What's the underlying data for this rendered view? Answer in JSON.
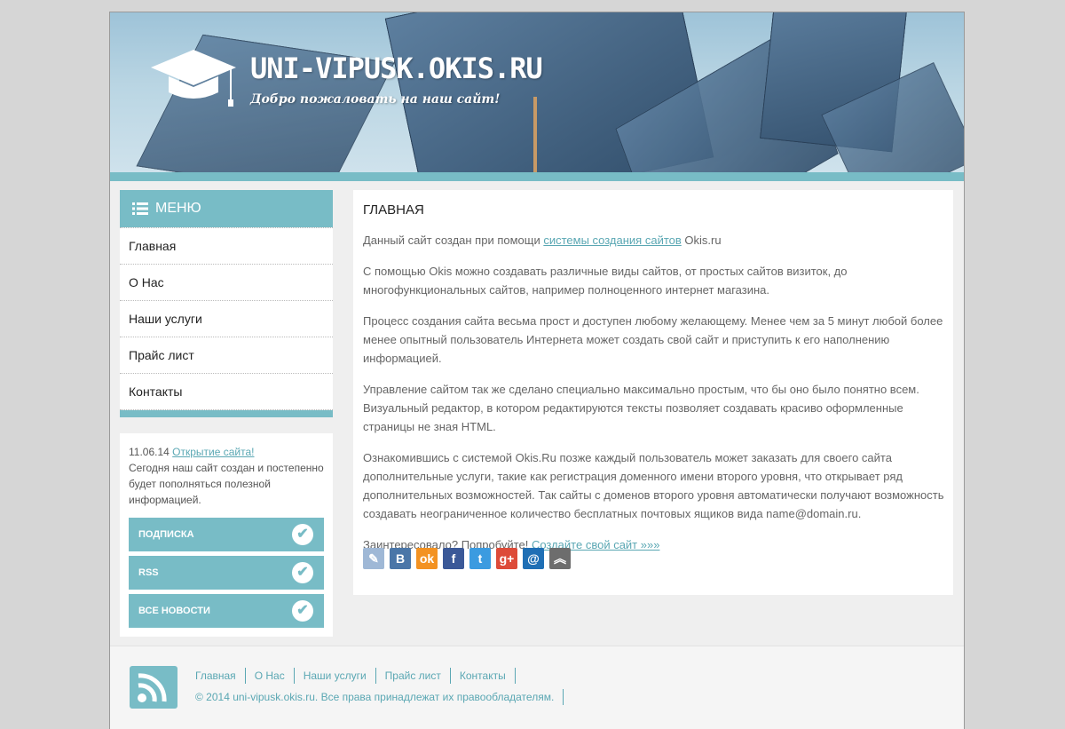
{
  "header": {
    "title": "UNI-VIPUSK.OKIS.RU",
    "subtitle": "Добро пожаловать на наш сайт!",
    "logo_icon": "graduation-cap-icon",
    "accent_color": "#78bcc6"
  },
  "menu": {
    "heading": "МЕНЮ",
    "items": [
      {
        "label": "Главная"
      },
      {
        "label": "О Нас"
      },
      {
        "label": "Наши услуги"
      },
      {
        "label": "Прайс лист"
      },
      {
        "label": "Контакты"
      }
    ]
  },
  "news": {
    "date": "11.06.14",
    "link": "Открытие сайта!",
    "text": "Сегодня наш сайт создан и постепенно будет пополняться полезной информацией.",
    "buttons": [
      {
        "label": "ПОДПИСКА"
      },
      {
        "label": "RSS"
      },
      {
        "label": "ВСЕ НОВОСТИ"
      }
    ]
  },
  "main": {
    "title": "ГЛАВНАЯ",
    "p1_before": "Данный сайт создан при помощи ",
    "p1_link": "системы создания сайтов",
    "p1_after": " Okis.ru",
    "p2": "С помощью Okis можно создавать различные виды сайтов, от простых сайтов визиток, до многофункциональных сайтов, например полноценного интернет магазина.",
    "p3": "Процесс создания сайта весьма прост и доступен любому желающему. Менее чем за 5 минут любой более менее опытный пользователь Интернета может создать свой сайт и приступить к его наполнению информацией.",
    "p4": "Управление сайтом так же сделано специально максимально простым, что бы оно было понятно всем. Визуальный редактор, в котором редактируются тексты позволяет создавать красиво оформленные страницы не зная HTML.",
    "p5": "Ознакомившись с системой Okis.Ru позже каждый пользователь может заказать для своего сайта дополнительные услуги, такие как регистрация доменного имени второго уровня, что открывает ряд дополнительных возможностей. Так сайты с доменов второго уровня автоматически получают возможность создавать неограниченное количество бесплатных почтовых ящиков вида name@domain.ru.",
    "p6_before": "Заинтересовало? Попробуйте! ",
    "p6_link": "Создайте свой сайт »»»",
    "social": [
      {
        "icon": "livejournal-icon",
        "glyph": "✎",
        "color": "#9fb8d6"
      },
      {
        "icon": "vk-icon",
        "glyph": "B",
        "color": "#4a76a8"
      },
      {
        "icon": "odnoklassniki-icon",
        "glyph": "ok",
        "color": "#f39222"
      },
      {
        "icon": "facebook-icon",
        "glyph": "f",
        "color": "#3b5998"
      },
      {
        "icon": "twitter-icon",
        "glyph": "t",
        "color": "#3b9be0"
      },
      {
        "icon": "google-plus-icon",
        "glyph": "g+",
        "color": "#dd4b39"
      },
      {
        "icon": "mail-ru-icon",
        "glyph": "@",
        "color": "#1f6fb5"
      },
      {
        "icon": "more-icon",
        "glyph": "︽",
        "color": "#6d6d6d"
      }
    ]
  },
  "footer": {
    "nav": [
      "Главная",
      "О Нас",
      "Наши услуги",
      "Прайс лист",
      "Контакты"
    ],
    "copyright": "© 2014 uni-vipusk.okis.ru. Все права принадлежат их правообладателям.",
    "rss_icon": "rss-icon"
  }
}
